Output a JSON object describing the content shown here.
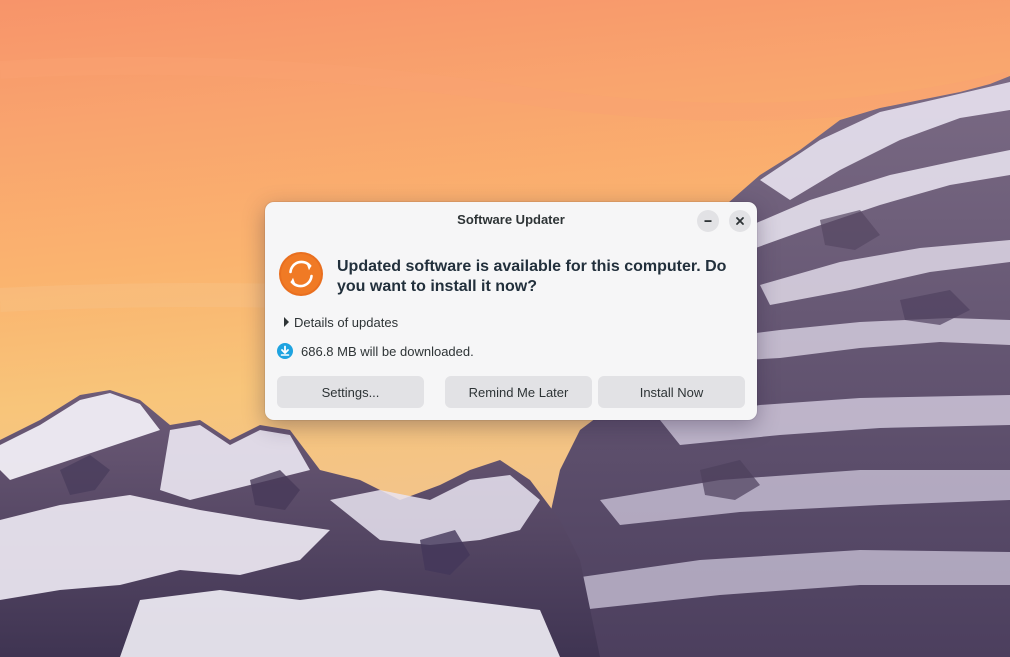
{
  "window": {
    "title": "Software Updater"
  },
  "titlebar_buttons": {
    "minimize_icon": "minimize-icon",
    "close_icon": "close-icon"
  },
  "message": {
    "headline": "Updated software is available for this computer. Do you want to install it now?",
    "details_label": "Details of updates",
    "download_text": "686.8 MB will be downloaded."
  },
  "icons": {
    "app": "software-updater-icon",
    "details": "disclosure-arrow-icon",
    "download": "download-icon"
  },
  "buttons": {
    "settings": "Settings...",
    "remind": "Remind Me Later",
    "install": "Install Now"
  },
  "colors": {
    "updater_orange": "#e96f1f",
    "download_blue": "#1ea3e0",
    "dialog_bg": "#f6f6f7",
    "button_bg": "#e2e2e5"
  }
}
